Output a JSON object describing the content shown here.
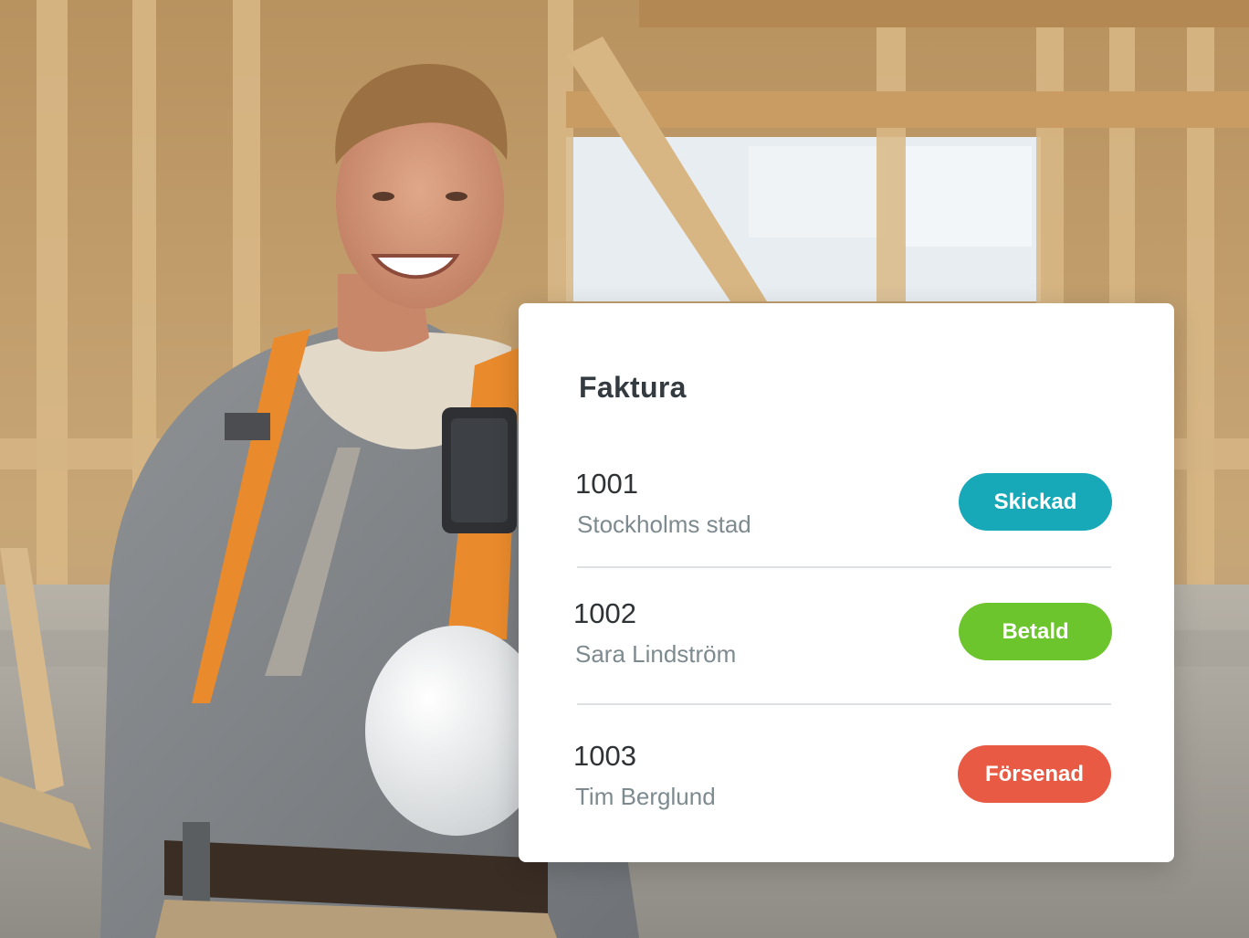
{
  "card": {
    "title": "Faktura"
  },
  "invoices": [
    {
      "number": "1001",
      "client": "Stockholms stad",
      "status": "Skickad",
      "status_color": "#17a9b8"
    },
    {
      "number": "1002",
      "client": "Sara Lindström",
      "status": "Betald",
      "status_color": "#6cc52c"
    },
    {
      "number": "1003",
      "client": "Tim Berglund",
      "status": "Försenad",
      "status_color": "#e95a44"
    }
  ]
}
